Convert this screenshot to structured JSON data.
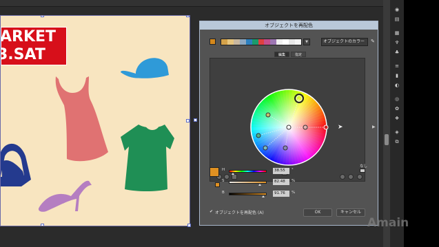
{
  "artboard": {
    "banner_line1": "ARKET",
    "banner_line2": "3.SAT"
  },
  "dialog": {
    "title": "オブジェクトを再配色",
    "color_strip": [
      "#d4a24a",
      "#e6c57e",
      "#c8b7a0",
      "#8fa8c0",
      "#2c7fbf",
      "#1b9a6b",
      "#e04040",
      "#c64e8d",
      "#9d77b3",
      "#f0f0f0",
      "#ffffff",
      "#e6e6e6",
      "#f2f2f2"
    ],
    "strip_dropdown_icon": "chevron-down-icon",
    "color_menu_label": "オブジェクトのカラー",
    "tabs": [
      "編集",
      "指定"
    ],
    "hsb": [
      {
        "label": "H",
        "value": "38.55",
        "unit": "°"
      },
      {
        "label": "S",
        "value": "82.48",
        "unit": "%"
      },
      {
        "label": "B",
        "value": "91.76",
        "unit": "%"
      }
    ],
    "hsb_fraction": [
      0.107,
      0.825,
      0.918
    ],
    "none_label": "なし",
    "recolor_checkbox_label": "オブジェクトを再配色 (A)",
    "recolor_checked": true,
    "ok_label": "OK",
    "cancel_label": "キャンセル",
    "active_color": "#e09122"
  },
  "watermark": "Amain"
}
